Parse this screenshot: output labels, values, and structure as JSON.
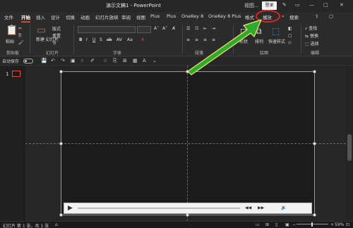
{
  "window": {
    "title": "演示文稿1 - PowerPoint",
    "signin_label": "登录",
    "quick_label": "视图..."
  },
  "tabs": [
    "文件",
    "开始",
    "插入",
    "设计",
    "切换",
    "动画",
    "幻灯片放映",
    "审阅",
    "视图",
    "Plus",
    "Plus",
    "OneKey 8",
    "OneKey 8 Plus",
    "格式",
    "播放"
  ],
  "active_tab": "开始",
  "search_label": "搜索",
  "ribbon": {
    "groups": [
      "剪贴板",
      "幻灯片",
      "字体",
      "段落",
      "绘图",
      "编辑"
    ],
    "paste": "粘贴",
    "new_slide": "新建\n幻灯片",
    "layout": "版式",
    "reset": "重置",
    "section": "节",
    "shape": "形状",
    "arrange": "排列",
    "quick_styles": "快速样式",
    "find": "查找",
    "replace": "替换",
    "select": "选择"
  },
  "qa_row": {
    "autosave": "自动保存",
    "toggle_state": "关"
  },
  "thumb_number": "1",
  "status": {
    "slide_info": "幻灯片 第 1 张，共 1 张",
    "zoom": "59%"
  },
  "annotation": {
    "circle_color": "#e02424",
    "arrow_color": "#2eaa2e",
    "target": "播放"
  },
  "accent": "#d24726"
}
